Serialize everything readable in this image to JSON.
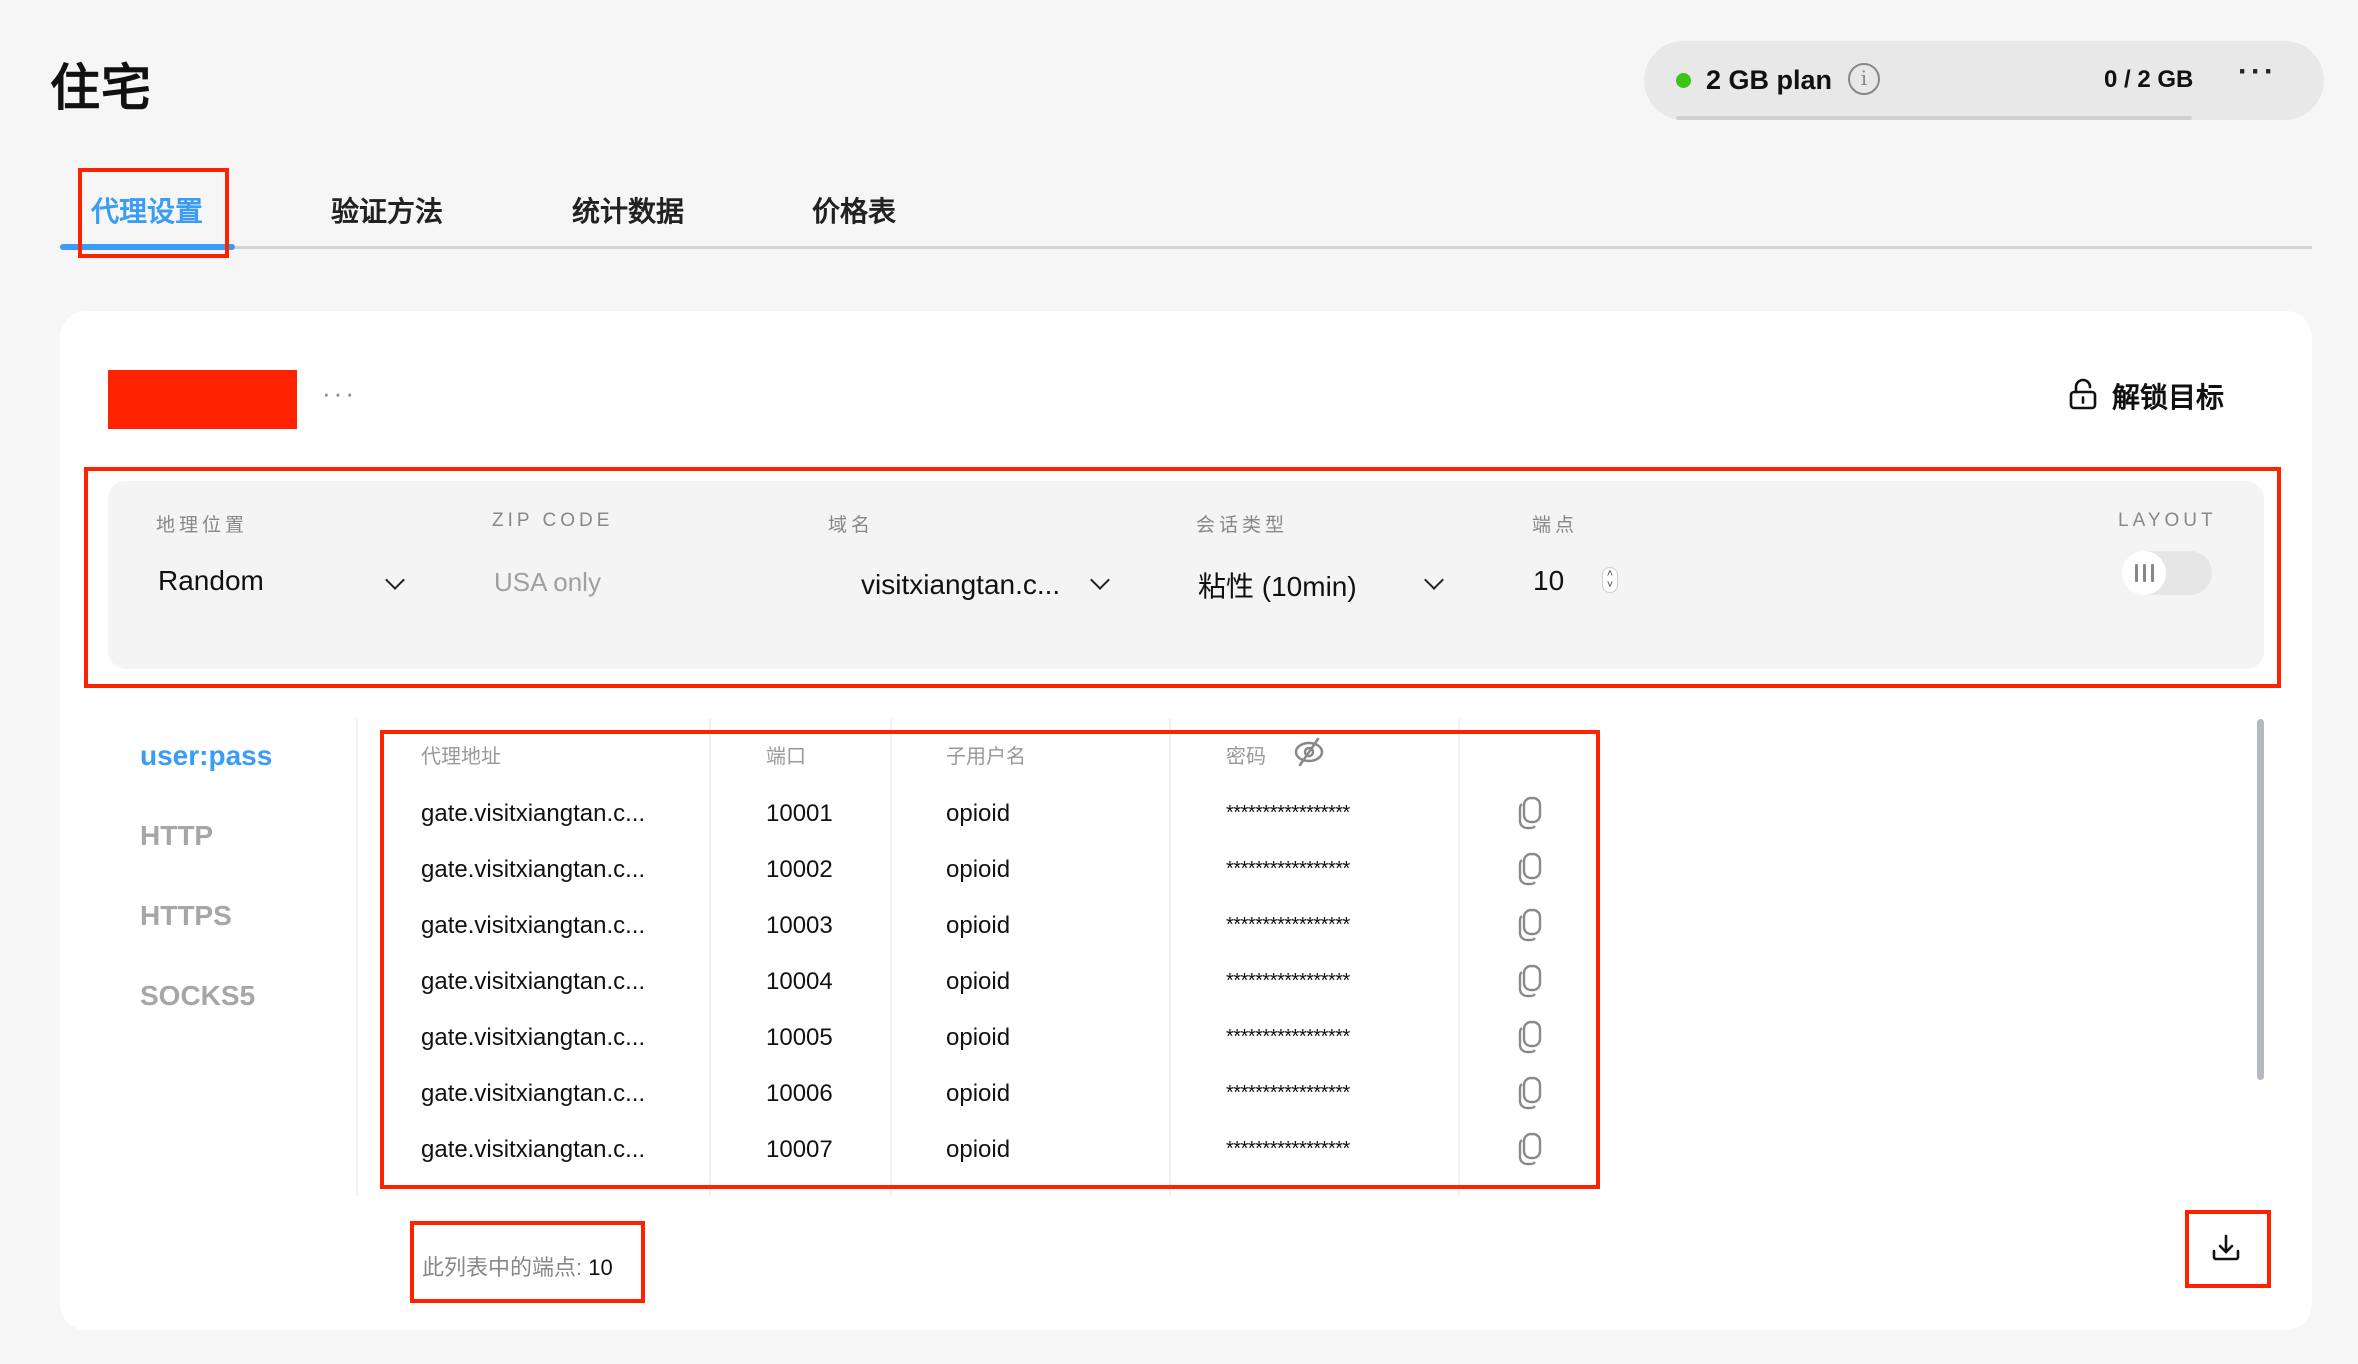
{
  "page": {
    "title": "住宅"
  },
  "plan": {
    "status_color": "#3cc518",
    "name": "2 GB plan",
    "info_icon": "info-icon",
    "usage": "0 / 2 GB",
    "usage_fraction": 0,
    "more_icon": "more-horizontal-icon"
  },
  "tabs": [
    {
      "label": "代理设置",
      "active": true
    },
    {
      "label": "验证方法",
      "active": false
    },
    {
      "label": "统计数据",
      "active": false
    },
    {
      "label": "价格表",
      "active": false
    }
  ],
  "card": {
    "more_label": "···",
    "unlock_label": "解锁目标",
    "unlock_icon": "unlock-icon"
  },
  "filters": {
    "geo": {
      "label": "地理位置",
      "value": "Random"
    },
    "zip": {
      "label": "ZIP CODE",
      "placeholder": "USA only"
    },
    "domain": {
      "label": "域名",
      "value": "visitxiangtan.c..."
    },
    "session": {
      "label": "会话类型",
      "value": "粘性 (10min)"
    },
    "endpoints": {
      "label": "端点",
      "value": "10"
    },
    "layout": {
      "label": "LAYOUT",
      "on": false
    }
  },
  "protocols": [
    {
      "label": "user:pass",
      "active": true
    },
    {
      "label": "HTTP",
      "active": false
    },
    {
      "label": "HTTPS",
      "active": false
    },
    {
      "label": "SOCKS5",
      "active": false
    }
  ],
  "table": {
    "headers": {
      "address": "代理地址",
      "port": "端口",
      "username": "子用户名",
      "password": "密码"
    },
    "rows": [
      {
        "address": "gate.visitxiangtan.c...",
        "port": "10001",
        "username": "opioid",
        "password": "*****************"
      },
      {
        "address": "gate.visitxiangtan.c...",
        "port": "10002",
        "username": "opioid",
        "password": "*****************"
      },
      {
        "address": "gate.visitxiangtan.c...",
        "port": "10003",
        "username": "opioid",
        "password": "*****************"
      },
      {
        "address": "gate.visitxiangtan.c...",
        "port": "10004",
        "username": "opioid",
        "password": "*****************"
      },
      {
        "address": "gate.visitxiangtan.c...",
        "port": "10005",
        "username": "opioid",
        "password": "*****************"
      },
      {
        "address": "gate.visitxiangtan.c...",
        "port": "10006",
        "username": "opioid",
        "password": "*****************"
      },
      {
        "address": "gate.visitxiangtan.c...",
        "port": "10007",
        "username": "opioid",
        "password": "*****************"
      }
    ]
  },
  "footer": {
    "count_label": "此列表中的端点: ",
    "count_value": "10",
    "download_icon": "download-icon"
  },
  "colors": {
    "accent": "#3b9cf5",
    "annotation": "#ff2200",
    "status_ok": "#3cc518"
  }
}
